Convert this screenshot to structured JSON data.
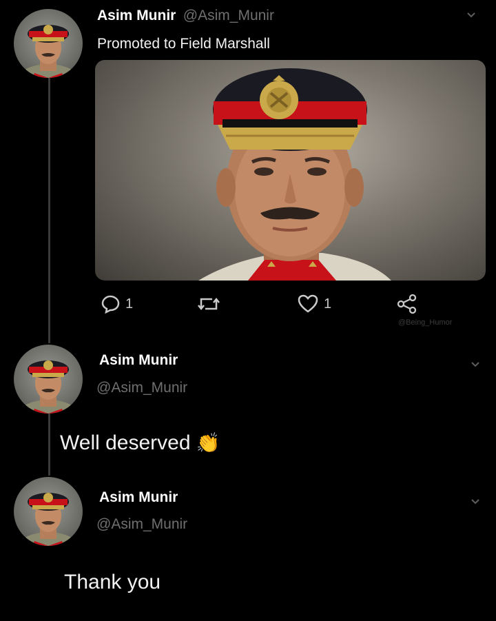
{
  "tweet_main": {
    "name": "Asim Munir",
    "handle": "@Asim_Munir",
    "text": "Promoted to Field Marshall",
    "stats": {
      "replies": "1",
      "likes": "1"
    },
    "watermark": "@Being_Humor"
  },
  "reply_1": {
    "name": "Asim Munir",
    "handle": "@Asim_Munir",
    "text": "Well deserved",
    "emoji": "👏"
  },
  "reply_2": {
    "name": "Asim Munir",
    "handle": "@Asim_Munir",
    "text": "Thank you"
  },
  "colors": {
    "background": "#000000",
    "thread_line": "#3a3a3a",
    "handle": "#6f6f6f",
    "beret_red": "#c8121a",
    "cap_dark": "#1a1a22",
    "gold": "#c9a94a"
  },
  "icons": [
    "reply-icon",
    "retweet-icon",
    "like-icon",
    "share-icon",
    "chevron-down-icon",
    "clap-icon"
  ]
}
